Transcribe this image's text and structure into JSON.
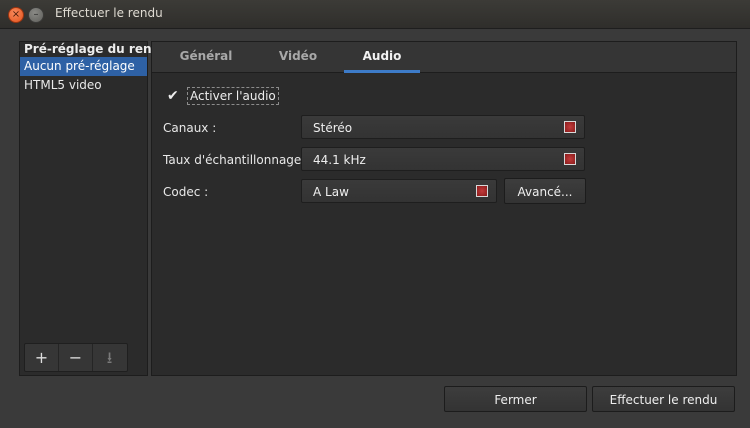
{
  "window": {
    "title": "Effectuer le rendu",
    "close_glyph": "×",
    "minimize_glyph": "–"
  },
  "presets": {
    "header": "Pré-réglage du rendu",
    "items": [
      "Aucun pré-réglage",
      "HTML5 video"
    ],
    "selected_index": 0,
    "toolbar": {
      "add": "+",
      "remove": "−",
      "save": "⭳"
    }
  },
  "tabs": [
    {
      "label": "Général",
      "active": false
    },
    {
      "label": "Vidéo",
      "active": false
    },
    {
      "label": "Audio",
      "active": true
    }
  ],
  "audio": {
    "enable_label": "Activer l'audio",
    "enable_checked": true,
    "checkmark": "✔",
    "channels_label": "Canaux :",
    "channels_value": "Stéréo",
    "sample_rate_label": "Taux d'échantillonnage :",
    "sample_rate_value": "44.1 kHz",
    "codec_label": "Codec :",
    "codec_value": "A Law",
    "advanced_label": "Avancé..."
  },
  "footer": {
    "close_label": "Fermer",
    "render_label": "Effectuer le rendu"
  },
  "colors": {
    "accent": "#3d7bc8",
    "selection": "#2e61a5",
    "background": "#3a3a3a"
  }
}
